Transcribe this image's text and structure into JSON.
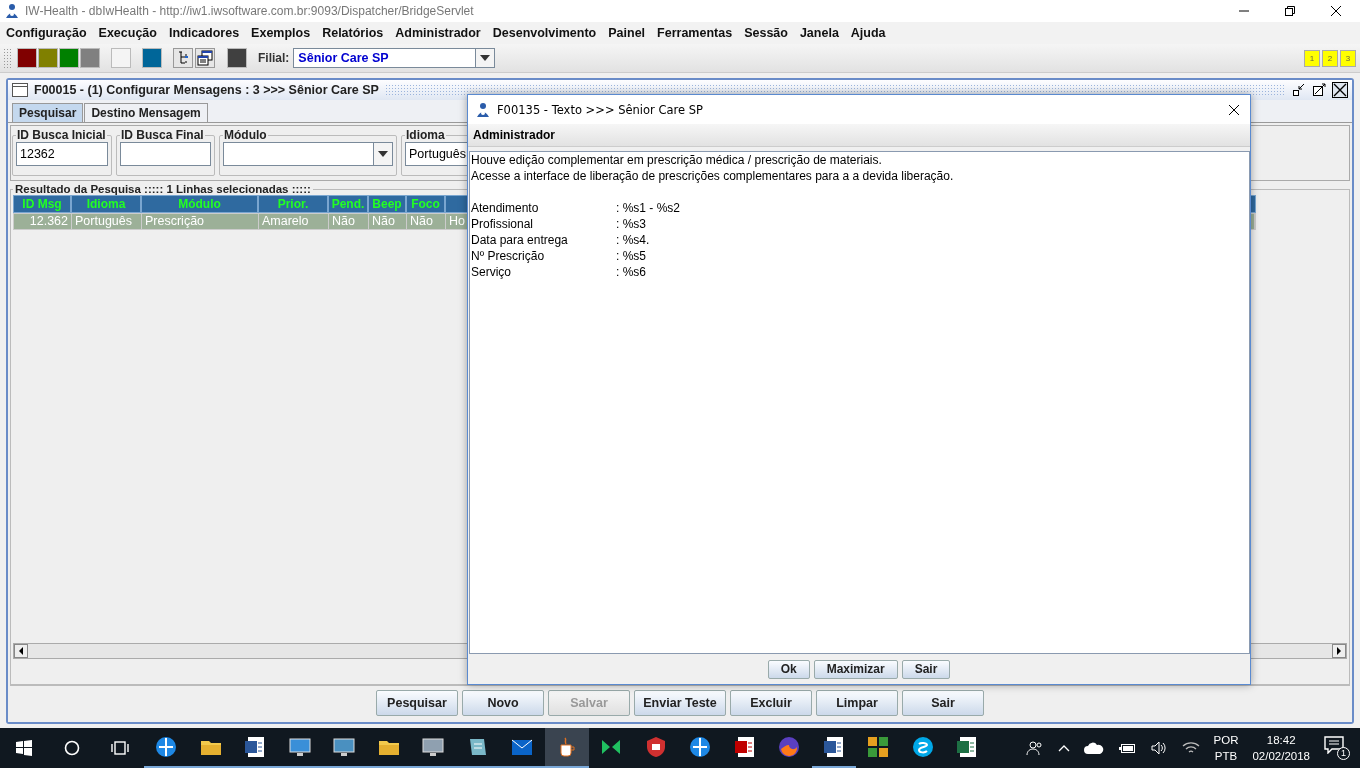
{
  "window": {
    "title": "IW-Health - dbIwHealth - http://iw1.iwsoftware.com.br:9093/Dispatcher/BridgeServlet"
  },
  "menu": [
    "Configuração",
    "Execução",
    "Indicadores",
    "Exemplos",
    "Relatórios",
    "Administrador",
    "Desenvolvimento",
    "Painel",
    "Ferramentas",
    "Sessão",
    "Janela",
    "Ajuda"
  ],
  "toolbar": {
    "tools": [
      {
        "kind": "swatch",
        "color": "#800000"
      },
      {
        "kind": "swatch",
        "color": "#808000"
      },
      {
        "kind": "swatch",
        "color": "#008000"
      },
      {
        "kind": "swatch",
        "color": "#808080"
      },
      {
        "kind": "swatch",
        "color": "#f4f4f4"
      },
      {
        "kind": "swatch",
        "color": "#006699"
      },
      {
        "kind": "tree"
      },
      {
        "kind": "windows"
      },
      {
        "kind": "swatch",
        "color": "#404040"
      }
    ],
    "branch_label": "Filial:",
    "branch_value": "Sênior Care SP",
    "quick_buttons": [
      "1",
      "2",
      "3"
    ]
  },
  "frame": {
    "title": "F00015 - (1) Configurar Mensagens : 3 >>> Sênior Care SP",
    "tabs": [
      {
        "label": "Pesquisar",
        "selected": true
      },
      {
        "label": "Destino Mensagem",
        "selected": false
      }
    ],
    "filters": [
      {
        "label": "ID Busca Inicial",
        "kind": "text",
        "value": "12362"
      },
      {
        "label": "ID Busca Final",
        "kind": "text"
      },
      {
        "label": "Módulo",
        "kind": "combo"
      },
      {
        "label": "Idioma",
        "kind": "text",
        "value": "Português"
      }
    ],
    "results": {
      "title": "Resultado da Pesquisa ::::: 1 Linhas selecionadas :::::",
      "columns": [
        "ID Msg",
        "Idioma",
        "Módulo",
        "Prior.",
        "Pend.",
        "Beep",
        "Foco"
      ],
      "rows": [
        {
          "selected": true,
          "cells": [
            "12.362",
            "Português",
            "Prescrição",
            "Amarelo",
            "Não",
            "Não",
            "Não",
            "Ho"
          ]
        }
      ]
    },
    "buttons": [
      {
        "label": "Pesquisar",
        "disabled": false
      },
      {
        "label": "Novo",
        "disabled": false
      },
      {
        "label": "Salvar",
        "disabled": true
      },
      {
        "label": "Enviar Teste",
        "disabled": false
      },
      {
        "label": "Excluir",
        "disabled": false
      },
      {
        "label": "Limpar",
        "disabled": false
      },
      {
        "label": "Sair",
        "disabled": false
      }
    ]
  },
  "dialog": {
    "title": "F00135 - Texto >>> Sênior Care SP",
    "header": "Administrador",
    "lines": [
      "Houve edição complementar em prescrição médica / prescrição de materiais.",
      "Acesse a interface de liberação de prescrições complementares para a a devida liberação."
    ],
    "fields": [
      {
        "label": "Atendimento",
        "value": ": %s1 - %s2"
      },
      {
        "label": "Profissional",
        "value": ": %s3"
      },
      {
        "label": "Data para entrega",
        "value": ": %s4."
      },
      {
        "label": "Nº Prescrição",
        "value": ": %s5"
      },
      {
        "label": "Serviço",
        "value": ": %s6"
      }
    ],
    "buttons": [
      "Ok",
      "Maximizar",
      "Sair"
    ]
  },
  "taskbar": {
    "apps": [
      {
        "kind": "globe",
        "selected": false,
        "running": true
      },
      {
        "kind": "folder",
        "selected": false,
        "running": true
      },
      {
        "kind": "document",
        "selected": false,
        "running": true
      },
      {
        "kind": "presentation",
        "selected": false,
        "running": true
      },
      {
        "kind": "computer",
        "selected": false,
        "running": true
      },
      {
        "kind": "folder",
        "selected": false,
        "running": true
      },
      {
        "kind": "monitor",
        "selected": false,
        "running": true
      },
      {
        "kind": "notepad",
        "selected": false,
        "running": true
      },
      {
        "kind": "mail",
        "selected": false,
        "running": true
      },
      {
        "kind": "cup",
        "selected": true,
        "running": true
      },
      {
        "kind": "bowtie",
        "selected": false,
        "running": false
      },
      {
        "kind": "shield",
        "selected": false,
        "running": false
      },
      {
        "kind": "globe",
        "selected": false,
        "running": false
      },
      {
        "kind": "pdf",
        "selected": false,
        "running": false
      },
      {
        "kind": "fox",
        "selected": false,
        "running": false
      },
      {
        "kind": "document",
        "selected": false,
        "running": true
      },
      {
        "kind": "grid",
        "selected": false,
        "running": false
      },
      {
        "kind": "chat",
        "selected": false,
        "running": false
      },
      {
        "kind": "sheet",
        "selected": false,
        "running": false
      }
    ],
    "language": [
      "POR",
      "PTB"
    ],
    "time": "18:42",
    "date": "02/02/2018",
    "notifications": "1"
  }
}
